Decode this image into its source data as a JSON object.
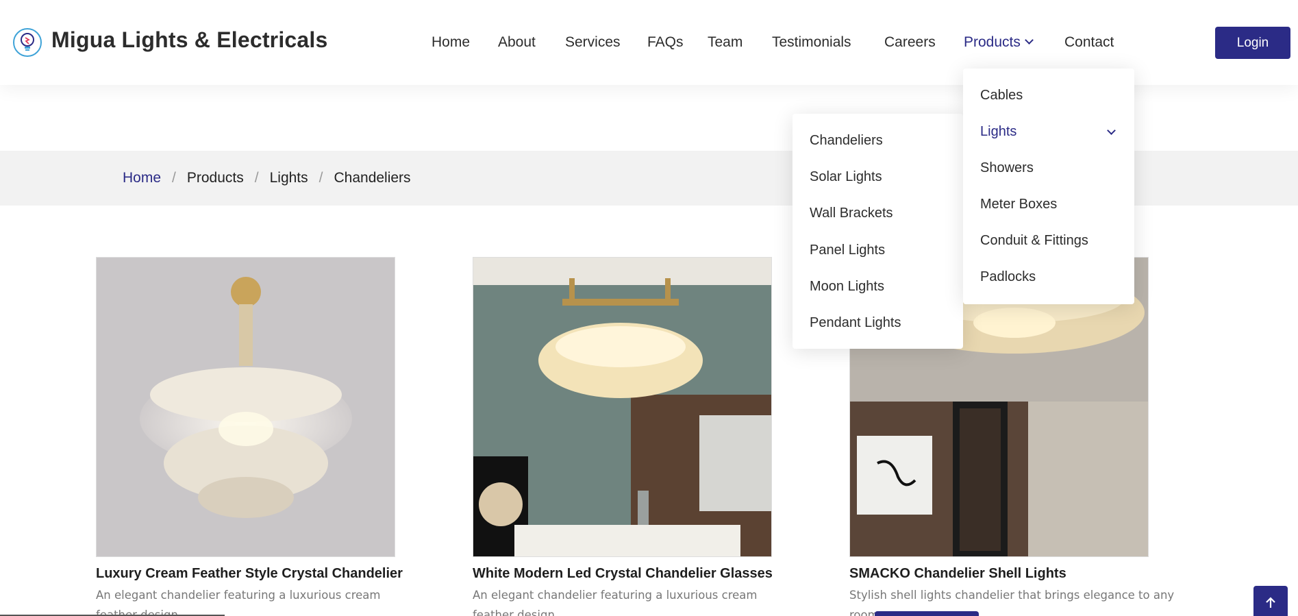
{
  "brand": {
    "name": "Migua Lights & Electricals",
    "logo_icon": "lightbulb-icon"
  },
  "nav": {
    "items": [
      {
        "label": "Home"
      },
      {
        "label": "About"
      },
      {
        "label": "Services"
      },
      {
        "label": "FAQs"
      },
      {
        "label": "Team"
      },
      {
        "label": "Testimonials"
      },
      {
        "label": "Careers"
      },
      {
        "label": "Products",
        "active": true
      },
      {
        "label": "Contact"
      }
    ],
    "login_label": "Login"
  },
  "breadcrumb": [
    "Home",
    "Products",
    "Lights",
    "Chandeliers"
  ],
  "products_menu": {
    "items": [
      "Cables",
      "Lights",
      "Showers",
      "Meter Boxes",
      "Conduit & Fittings",
      "Padlocks"
    ],
    "active": "Lights"
  },
  "lights_submenu": {
    "items": [
      "Chandeliers",
      "Solar Lights",
      "Wall Brackets",
      "Panel Lights",
      "Moon Lights",
      "Pendant Lights"
    ]
  },
  "products": [
    {
      "title": "Luxury Cream Feather Style Crystal Chandelier",
      "description": "An elegant chandelier featuring a luxurious cream feather design."
    },
    {
      "title": "White Modern Led Crystal Chandelier Glasses",
      "description": "An elegant chandelier featuring a luxurious cream feather design."
    },
    {
      "title": "SMACKO Chandelier Shell Lights",
      "description": "Stylish shell lights chandelier that brings elegance to any room."
    }
  ],
  "colors": {
    "accent": "#2b2b86",
    "band": "#f2f2f2"
  },
  "scroll_top_icon": "arrow-up-icon"
}
